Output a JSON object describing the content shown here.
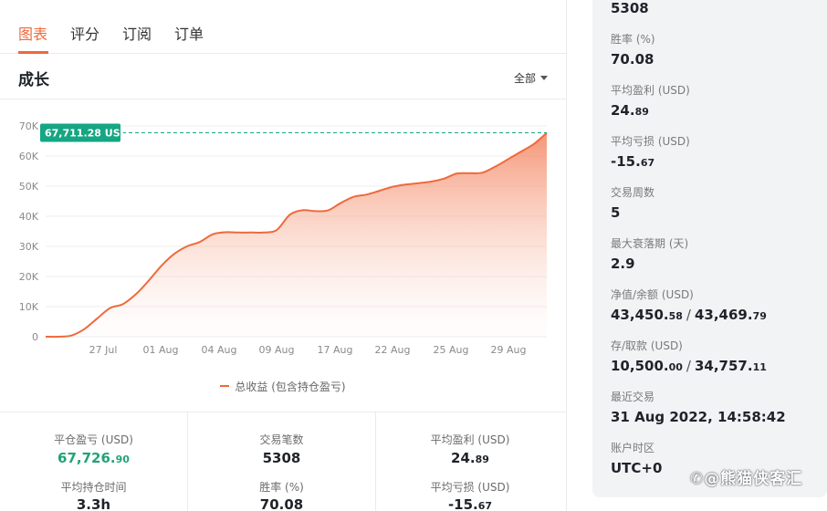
{
  "tabs": [
    {
      "label": "图表",
      "active": true
    },
    {
      "label": "评分",
      "active": false
    },
    {
      "label": "订阅",
      "active": false
    },
    {
      "label": "订单",
      "active": false
    }
  ],
  "section": {
    "title": "成长",
    "range_label": "全部"
  },
  "chart_data": {
    "type": "area",
    "title": "",
    "xlabel": "",
    "ylabel": "",
    "x": [
      "2022-07-23",
      "2022-07-24",
      "2022-07-25",
      "2022-07-26",
      "2022-07-27",
      "2022-07-28",
      "2022-07-29",
      "2022-07-30",
      "2022-07-31",
      "2022-08-01",
      "2022-08-02",
      "2022-08-03",
      "2022-08-04",
      "2022-08-05",
      "2022-08-06",
      "2022-08-07",
      "2022-08-08",
      "2022-08-09",
      "2022-08-10",
      "2022-08-11",
      "2022-08-12",
      "2022-08-13",
      "2022-08-14",
      "2022-08-15",
      "2022-08-16",
      "2022-08-17",
      "2022-08-18",
      "2022-08-19",
      "2022-08-20",
      "2022-08-21",
      "2022-08-22",
      "2022-08-23",
      "2022-08-24",
      "2022-08-25",
      "2022-08-26",
      "2022-08-27",
      "2022-08-28",
      "2022-08-29",
      "2022-08-30",
      "2022-08-31"
    ],
    "series": [
      {
        "name": "总收益 (包含持仓盈亏)",
        "values": [
          0,
          0,
          400,
          2500,
          6000,
          9500,
          10800,
          14000,
          18500,
          23500,
          27500,
          30000,
          31500,
          34000,
          34700,
          34600,
          34600,
          34600,
          35500,
          40500,
          42000,
          41700,
          42000,
          44500,
          46500,
          47200,
          48500,
          49800,
          50500,
          51000,
          51500,
          52500,
          54200,
          54300,
          54500,
          56500,
          59000,
          61500,
          64000,
          67711.28
        ]
      }
    ],
    "y_ticks": [
      "0",
      "10K",
      "20K",
      "30K",
      "40K",
      "50K",
      "60K",
      "70K"
    ],
    "x_ticks": [
      "27 Jul",
      "01 Aug",
      "04 Aug",
      "09 Aug",
      "17 Aug",
      "22 Aug",
      "25 Aug",
      "29 Aug"
    ],
    "ylim": [
      0,
      70000
    ],
    "grid": true,
    "last_value_label": "67,711.28 USD",
    "colors": {
      "line": "#ee6a3b",
      "fill": "#f7a58a",
      "marker": "#16a684"
    }
  },
  "stats": {
    "closed_pl_label": "平仓盈亏 (USD)",
    "closed_pl_int": "67,726.",
    "closed_pl_dec": "90",
    "avg_hold_label": "平均持仓时间",
    "avg_hold_value": "3.3h",
    "trades_label": "交易笔数",
    "trades_value": "5308",
    "winrate_label": "胜率 (%)",
    "winrate_value": "70.08",
    "avg_profit_label": "平均盈利 (USD)",
    "avg_profit_int": "24.",
    "avg_profit_dec": "89",
    "avg_loss_label": "平均亏损 (USD)",
    "avg_loss_int": "-15.",
    "avg_loss_dec": "67"
  },
  "info": {
    "trades_value": "5308",
    "winrate_label": "胜率 (%)",
    "winrate_value": "70.08",
    "avg_profit_label": "平均盈利 (USD)",
    "avg_profit_int": "24.",
    "avg_profit_dec": "89",
    "avg_loss_label": "平均亏损 (USD)",
    "avg_loss_int": "-15.",
    "avg_loss_dec": "67",
    "weeks_label": "交易周数",
    "weeks_value": "5",
    "max_dd_label": "最大衰落期 (天)",
    "max_dd_value": "2.9",
    "equity_label": "净值/余额 (USD)",
    "equity_int": "43,450.",
    "equity_dec": "58",
    "balance_int": "43,469.",
    "balance_dec": "79",
    "deposit_label": "存/取款 (USD)",
    "deposit_int": "10,500.",
    "deposit_dec": "00",
    "withdraw_int": "34,757.",
    "withdraw_dec": "11",
    "last_trade_label": "最近交易",
    "last_trade_value": "31 Aug 2022, 14:58:42",
    "timezone_label": "账户时区",
    "timezone_value": "UTC+0",
    "separator": "/"
  },
  "watermark": "✆@熊猫侠客汇"
}
